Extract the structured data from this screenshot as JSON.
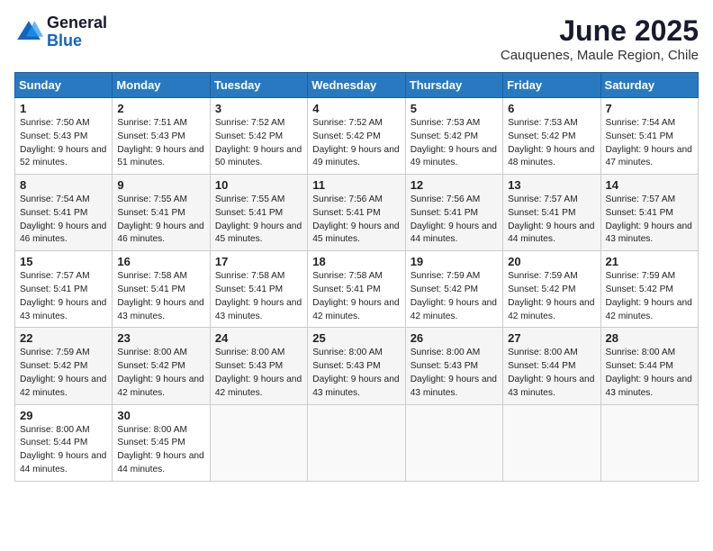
{
  "logo": {
    "general": "General",
    "blue": "Blue"
  },
  "title": {
    "month_year": "June 2025",
    "location": "Cauquenes, Maule Region, Chile"
  },
  "header": {
    "days": [
      "Sunday",
      "Monday",
      "Tuesday",
      "Wednesday",
      "Thursday",
      "Friday",
      "Saturday"
    ]
  },
  "weeks": [
    [
      {
        "day": "1",
        "sunrise": "7:50 AM",
        "sunset": "5:43 PM",
        "daylight": "9 hours and 52 minutes."
      },
      {
        "day": "2",
        "sunrise": "7:51 AM",
        "sunset": "5:43 PM",
        "daylight": "9 hours and 51 minutes."
      },
      {
        "day": "3",
        "sunrise": "7:52 AM",
        "sunset": "5:42 PM",
        "daylight": "9 hours and 50 minutes."
      },
      {
        "day": "4",
        "sunrise": "7:52 AM",
        "sunset": "5:42 PM",
        "daylight": "9 hours and 49 minutes."
      },
      {
        "day": "5",
        "sunrise": "7:53 AM",
        "sunset": "5:42 PM",
        "daylight": "9 hours and 49 minutes."
      },
      {
        "day": "6",
        "sunrise": "7:53 AM",
        "sunset": "5:42 PM",
        "daylight": "9 hours and 48 minutes."
      },
      {
        "day": "7",
        "sunrise": "7:54 AM",
        "sunset": "5:41 PM",
        "daylight": "9 hours and 47 minutes."
      }
    ],
    [
      {
        "day": "8",
        "sunrise": "7:54 AM",
        "sunset": "5:41 PM",
        "daylight": "9 hours and 46 minutes."
      },
      {
        "day": "9",
        "sunrise": "7:55 AM",
        "sunset": "5:41 PM",
        "daylight": "9 hours and 46 minutes."
      },
      {
        "day": "10",
        "sunrise": "7:55 AM",
        "sunset": "5:41 PM",
        "daylight": "9 hours and 45 minutes."
      },
      {
        "day": "11",
        "sunrise": "7:56 AM",
        "sunset": "5:41 PM",
        "daylight": "9 hours and 45 minutes."
      },
      {
        "day": "12",
        "sunrise": "7:56 AM",
        "sunset": "5:41 PM",
        "daylight": "9 hours and 44 minutes."
      },
      {
        "day": "13",
        "sunrise": "7:57 AM",
        "sunset": "5:41 PM",
        "daylight": "9 hours and 44 minutes."
      },
      {
        "day": "14",
        "sunrise": "7:57 AM",
        "sunset": "5:41 PM",
        "daylight": "9 hours and 43 minutes."
      }
    ],
    [
      {
        "day": "15",
        "sunrise": "7:57 AM",
        "sunset": "5:41 PM",
        "daylight": "9 hours and 43 minutes."
      },
      {
        "day": "16",
        "sunrise": "7:58 AM",
        "sunset": "5:41 PM",
        "daylight": "9 hours and 43 minutes."
      },
      {
        "day": "17",
        "sunrise": "7:58 AM",
        "sunset": "5:41 PM",
        "daylight": "9 hours and 43 minutes."
      },
      {
        "day": "18",
        "sunrise": "7:58 AM",
        "sunset": "5:41 PM",
        "daylight": "9 hours and 42 minutes."
      },
      {
        "day": "19",
        "sunrise": "7:59 AM",
        "sunset": "5:42 PM",
        "daylight": "9 hours and 42 minutes."
      },
      {
        "day": "20",
        "sunrise": "7:59 AM",
        "sunset": "5:42 PM",
        "daylight": "9 hours and 42 minutes."
      },
      {
        "day": "21",
        "sunrise": "7:59 AM",
        "sunset": "5:42 PM",
        "daylight": "9 hours and 42 minutes."
      }
    ],
    [
      {
        "day": "22",
        "sunrise": "7:59 AM",
        "sunset": "5:42 PM",
        "daylight": "9 hours and 42 minutes."
      },
      {
        "day": "23",
        "sunrise": "8:00 AM",
        "sunset": "5:42 PM",
        "daylight": "9 hours and 42 minutes."
      },
      {
        "day": "24",
        "sunrise": "8:00 AM",
        "sunset": "5:43 PM",
        "daylight": "9 hours and 42 minutes."
      },
      {
        "day": "25",
        "sunrise": "8:00 AM",
        "sunset": "5:43 PM",
        "daylight": "9 hours and 43 minutes."
      },
      {
        "day": "26",
        "sunrise": "8:00 AM",
        "sunset": "5:43 PM",
        "daylight": "9 hours and 43 minutes."
      },
      {
        "day": "27",
        "sunrise": "8:00 AM",
        "sunset": "5:44 PM",
        "daylight": "9 hours and 43 minutes."
      },
      {
        "day": "28",
        "sunrise": "8:00 AM",
        "sunset": "5:44 PM",
        "daylight": "9 hours and 43 minutes."
      }
    ],
    [
      {
        "day": "29",
        "sunrise": "8:00 AM",
        "sunset": "5:44 PM",
        "daylight": "9 hours and 44 minutes."
      },
      {
        "day": "30",
        "sunrise": "8:00 AM",
        "sunset": "5:45 PM",
        "daylight": "9 hours and 44 minutes."
      },
      null,
      null,
      null,
      null,
      null
    ]
  ],
  "labels": {
    "sunrise": "Sunrise:",
    "sunset": "Sunset:",
    "daylight": "Daylight:"
  }
}
